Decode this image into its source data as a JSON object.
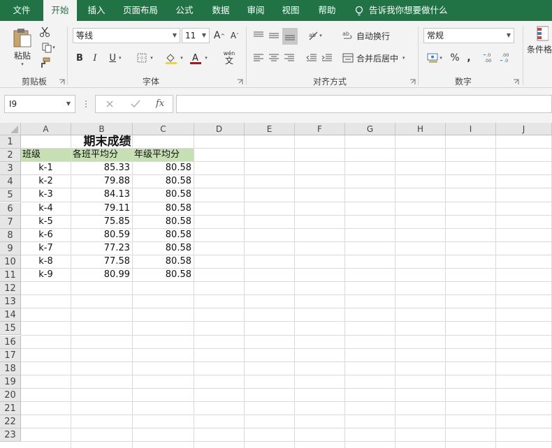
{
  "menu": {
    "tabs": [
      "文件",
      "开始",
      "插入",
      "页面布局",
      "公式",
      "数据",
      "审阅",
      "视图",
      "帮助"
    ],
    "active_tab": "开始",
    "tell_me": "告诉我你想要做什么"
  },
  "ribbon": {
    "clipboard": {
      "paste_label": "粘贴",
      "group_label": "剪贴板"
    },
    "font": {
      "font_name": "等线",
      "font_size": "11",
      "bold": "B",
      "italic": "I",
      "underline": "U",
      "grow": "A",
      "shrink": "A",
      "wen": "wén",
      "wen_char": "文",
      "group_label": "字体"
    },
    "alignment": {
      "wrap_text": "自动换行",
      "merge_center": "合并后居中",
      "group_label": "对齐方式"
    },
    "number": {
      "format": "常规",
      "percent": "%",
      "comma": ",",
      "inc_decimal": "←.0\n.00",
      "group_label": "数字"
    },
    "styles": {
      "cond_format": "条件格"
    }
  },
  "formula_bar": {
    "name_box": "I9",
    "fx": "fx",
    "formula": ""
  },
  "sheet": {
    "columns": [
      "A",
      "B",
      "C",
      "D",
      "E",
      "F",
      "G",
      "H",
      "I",
      "J"
    ],
    "rows": [
      "1",
      "2",
      "3",
      "4",
      "5",
      "6",
      "7",
      "8",
      "9",
      "10",
      "11",
      "12",
      "13",
      "14",
      "15",
      "16",
      "17",
      "18",
      "19",
      "20",
      "21",
      "22",
      "23"
    ],
    "title": "期末成绩",
    "headers": [
      "班级",
      "各班平均分",
      "年级平均分"
    ],
    "data": [
      [
        "k-1",
        "85.33",
        "80.58"
      ],
      [
        "k-2",
        "79.88",
        "80.58"
      ],
      [
        "k-3",
        "84.13",
        "80.58"
      ],
      [
        "k-4",
        "79.11",
        "80.58"
      ],
      [
        "k-5",
        "75.85",
        "80.58"
      ],
      [
        "k-6",
        "80.59",
        "80.58"
      ],
      [
        "k-7",
        "77.23",
        "80.58"
      ],
      [
        "k-8",
        "77.58",
        "80.58"
      ],
      [
        "k-9",
        "80.99",
        "80.58"
      ]
    ],
    "header_fill": "#c6e0b4"
  },
  "colors": {
    "brand": "#217346",
    "ribbon_bg": "#f3f3f3",
    "grid": "#dadada"
  }
}
